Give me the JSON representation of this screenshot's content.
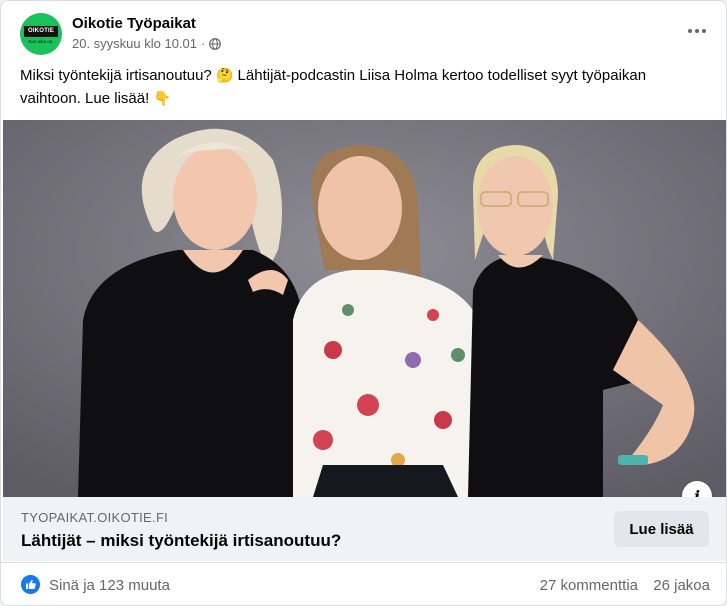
{
  "post": {
    "page_name": "Oikotie Työpaikat",
    "logo_text": "OIKOTIE",
    "logo_subtext": "Kun aika on.",
    "timestamp": "20. syyskuu klo 10.01",
    "separator": "·",
    "text_part1": "Miksi työntekijä irtisanoutuu?",
    "text_part2": "Lähtijät-podcastin Liisa Holma kertoo todelliset syyt työpaikan vaihtoon. Lue lisää!",
    "emoji_thinking": "🤔",
    "emoji_point": "👇"
  },
  "link_preview": {
    "domain": "TYOPAIKAT.OIKOTIE.FI",
    "title": "Lähtijät – miksi työntekijä irtisanoutuu?",
    "cta_label": "Lue lisää",
    "info_label": "i"
  },
  "footer": {
    "reactions": "Sinä ja 123 muuta",
    "comments": "27 kommenttia",
    "shares": "26 jakoa"
  },
  "colors": {
    "brand_green": "#19c25a",
    "like_blue": "#1877f2"
  },
  "icons": [
    "globe-icon",
    "more-options-icon",
    "info-icon",
    "like-icon"
  ]
}
